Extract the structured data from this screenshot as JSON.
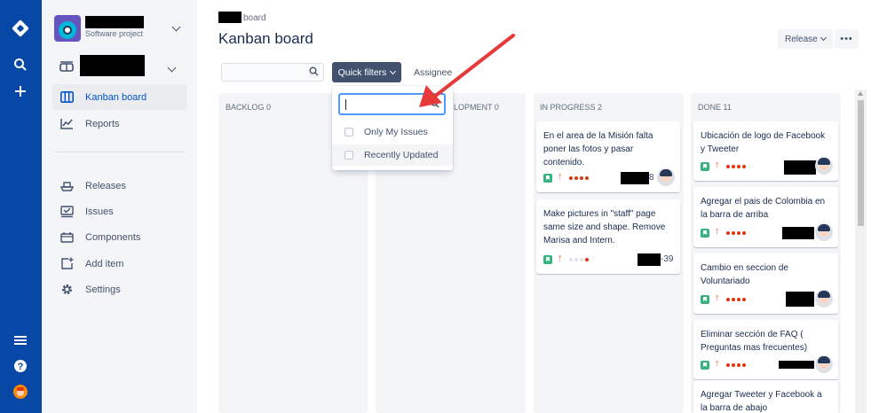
{
  "project": {
    "subtitle": "Software project"
  },
  "sidebar": {
    "items": [
      {
        "label": "Kanban board",
        "icon": "board-icon"
      },
      {
        "label": "Reports",
        "icon": "chart-icon"
      },
      {
        "label": "Releases",
        "icon": "ship-icon"
      },
      {
        "label": "Issues",
        "icon": "issues-icon"
      },
      {
        "label": "Components",
        "icon": "components-icon"
      },
      {
        "label": "Add item",
        "icon": "add-item-icon"
      },
      {
        "label": "Settings",
        "icon": "gear-icon"
      }
    ]
  },
  "header": {
    "breadcrumb_suffix": "board",
    "title": "Kanban board",
    "release_label": "Release",
    "more_label": "•••"
  },
  "filters": {
    "quick_filters_label": "Quick filters",
    "assignee_label": "Assignee"
  },
  "dropdown": {
    "options": [
      "Only My Issues",
      "Recently Updated"
    ]
  },
  "columns": [
    {
      "title": "BACKLOG 0"
    },
    {
      "title": "LOPMENT 0"
    },
    {
      "title": "IN PROGRESS 2"
    },
    {
      "title": "DONE 11"
    }
  ],
  "in_progress_cards": [
    {
      "text": "En el area de la Misión falta poner las fotos y pasar contenido.",
      "key": "8"
    },
    {
      "text": "Make pictures in \"staff\" page same size and shape. Remove Marisa and Intern.",
      "key": "-39"
    }
  ],
  "done_cards": [
    {
      "text": "Ubicación de logo de Facebook y Tweeter"
    },
    {
      "text": "Agregar el pais de Colombia en la barra de arriba"
    },
    {
      "text": "Cambio en seccion de Voluntariado"
    },
    {
      "text": "Eliminar sección de FAQ ( Preguntas mas frecuentes)"
    },
    {
      "text": "Agregar Tweeter y Facebook a la barra de abajo"
    }
  ],
  "colors": {
    "global_nav": "#0747a6",
    "sidebar_bg": "#f4f5f7",
    "active_link": "#0052cc",
    "story_green": "#36b37e",
    "priority_red": "#ff5630",
    "quick_filter_bg": "#42526e",
    "annotation_arrow": "#e5393a"
  }
}
